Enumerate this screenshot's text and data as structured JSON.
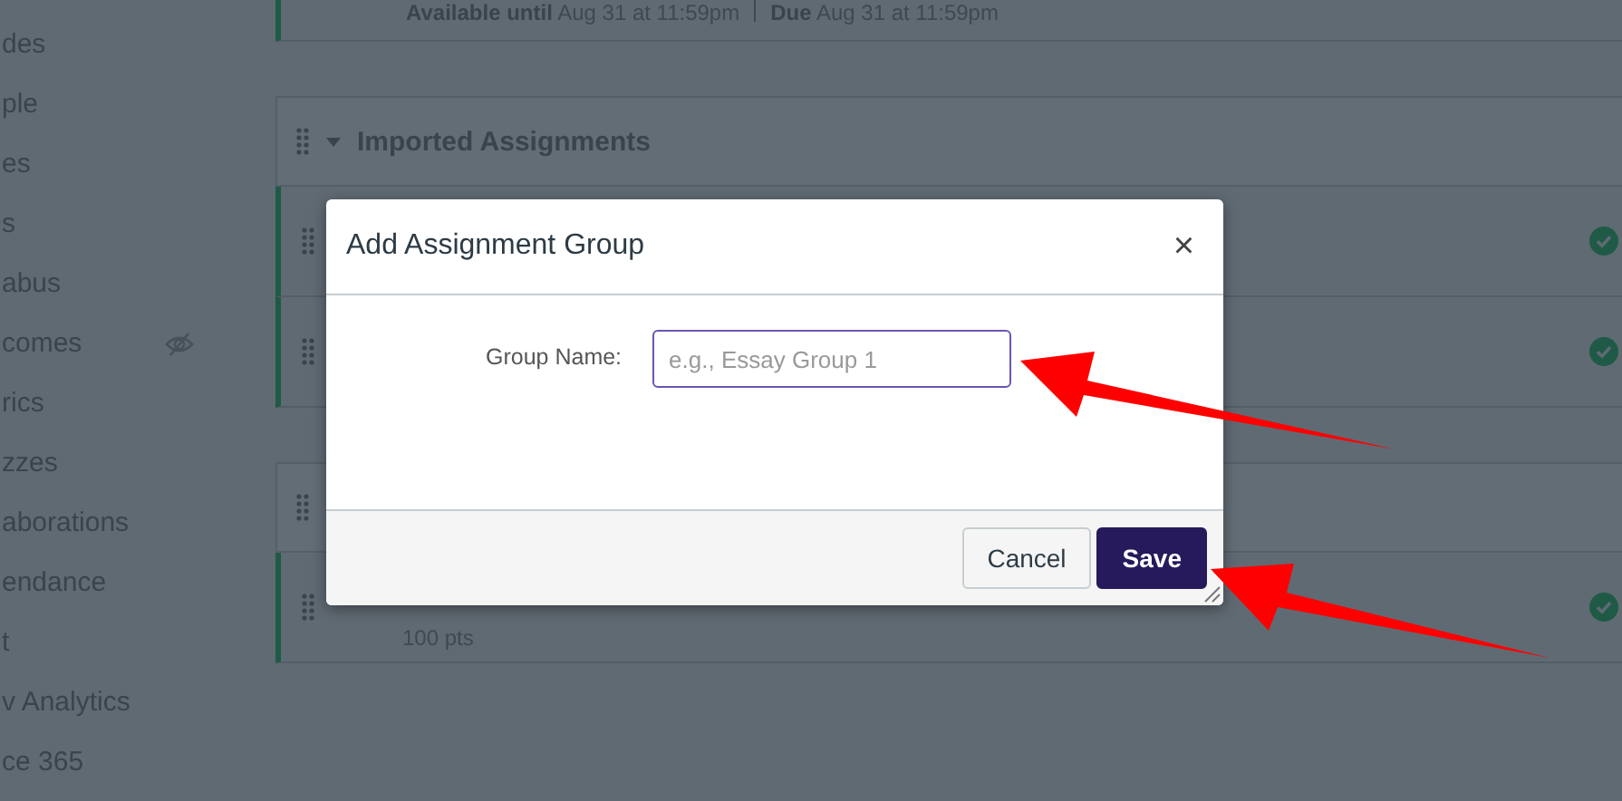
{
  "sidebar": {
    "items": [
      {
        "label": "des",
        "hidden": false
      },
      {
        "label": "ple",
        "hidden": false
      },
      {
        "label": "es",
        "hidden": false
      },
      {
        "label": "s",
        "hidden": false
      },
      {
        "label": "abus",
        "hidden": false
      },
      {
        "label": "comes",
        "hidden": true
      },
      {
        "label": "rics",
        "hidden": false
      },
      {
        "label": "zzes",
        "hidden": false
      },
      {
        "label": "aborations",
        "hidden": false
      },
      {
        "label": "endance",
        "hidden": false
      },
      {
        "label": "t",
        "hidden": false
      },
      {
        "label": "v Analytics",
        "hidden": false
      },
      {
        "label": "ce 365",
        "hidden": false
      }
    ]
  },
  "top_row": {
    "availability": "**Available until** Aug 31 at 11:59pm",
    "due": "**Due** Aug 31 at 11:59pm"
  },
  "groups": [
    {
      "title": "Imported Assignments",
      "expanded": true,
      "rows": [
        {
          "published": true
        },
        {
          "published": true
        }
      ]
    },
    {
      "rows": [
        {
          "points": "100 pts",
          "published": true
        }
      ]
    }
  ],
  "dialog": {
    "title": "Add Assignment Group",
    "close": "×",
    "field_label": "Group Name:",
    "placeholder": "e.g., Essay Group 1",
    "buttons": [
      {
        "label": "Cancel",
        "kind": "secondary"
      },
      {
        "label": "Save",
        "kind": "primary"
      }
    ]
  }
}
